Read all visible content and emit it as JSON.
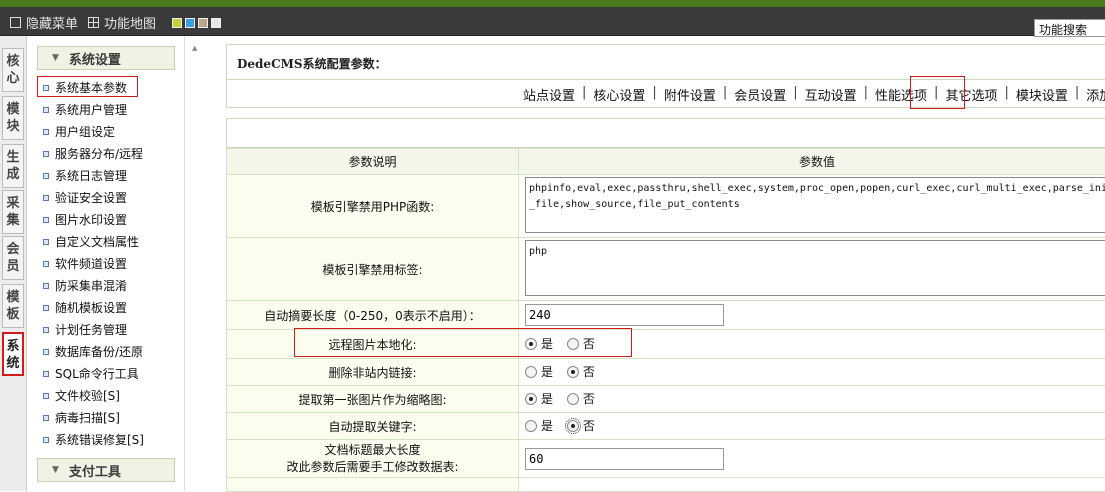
{
  "topbar": {
    "hide_menu": "隐藏菜单",
    "func_map": "功能地图",
    "swatches": [
      "#c8d23a",
      "#3aa0e0",
      "#b7a58c",
      "#e8e8e8"
    ],
    "search": "功能搜索"
  },
  "vtabs": [
    {
      "label": "核\n心",
      "active": false
    },
    {
      "label": "模\n块",
      "active": false
    },
    {
      "label": "生\n成",
      "active": false
    },
    {
      "label": "采\n集",
      "active": false
    },
    {
      "label": "会\n员",
      "active": false
    },
    {
      "label": "模\n板",
      "active": false
    },
    {
      "label": "系\n统",
      "active": true
    }
  ],
  "menu": {
    "section1": "系统设置",
    "items": [
      "系统基本参数",
      "系统用户管理",
      "用户组设定",
      "服务器分布/远程",
      "系统日志管理",
      "验证安全设置",
      "图片水印设置",
      "自定义文档属性",
      "软件频道设置",
      "防采集串混淆",
      "随机模板设置",
      "计划任务管理",
      "数据库备份/还原",
      "SQL命令行工具",
      "文件校验[S]",
      "病毒扫描[S]",
      "系统错误修复[S]"
    ],
    "section2": "支付工具"
  },
  "main": {
    "title": "DedeCMS系统配置参数：",
    "tabs": [
      "站点设置",
      "核心设置",
      "附件设置",
      "会员设置",
      "互动设置",
      "性能选项",
      "其它选项",
      "模块设置",
      "添加新变量"
    ],
    "col_desc": "参数说明",
    "col_value": "参数值",
    "rows": {
      "r1_label": "模板引擎禁用PHP函数:",
      "r1_value": "phpinfo,eval,exec,passthru,shell_exec,system,proc_open,popen,curl_exec,curl_multi_exec,parse_ini_file,show_source,file_put_contents",
      "r2_label": "模板引擎禁用标签:",
      "r2_value": "php",
      "r3_label": "自动摘要长度（0-250，0表示不启用）：",
      "r3_value": "240",
      "r4_label": "远程图片本地化:",
      "r5_label": "删除非站内链接:",
      "r6_label": "提取第一张图片作为缩略图:",
      "r7_label": "自动提取关键字:",
      "r8_label_1": "文档标题最大长度",
      "r8_label_2": "改此参数后需要手工修改数据表:",
      "r8_value": "60",
      "yes": "是",
      "no": "否"
    }
  }
}
